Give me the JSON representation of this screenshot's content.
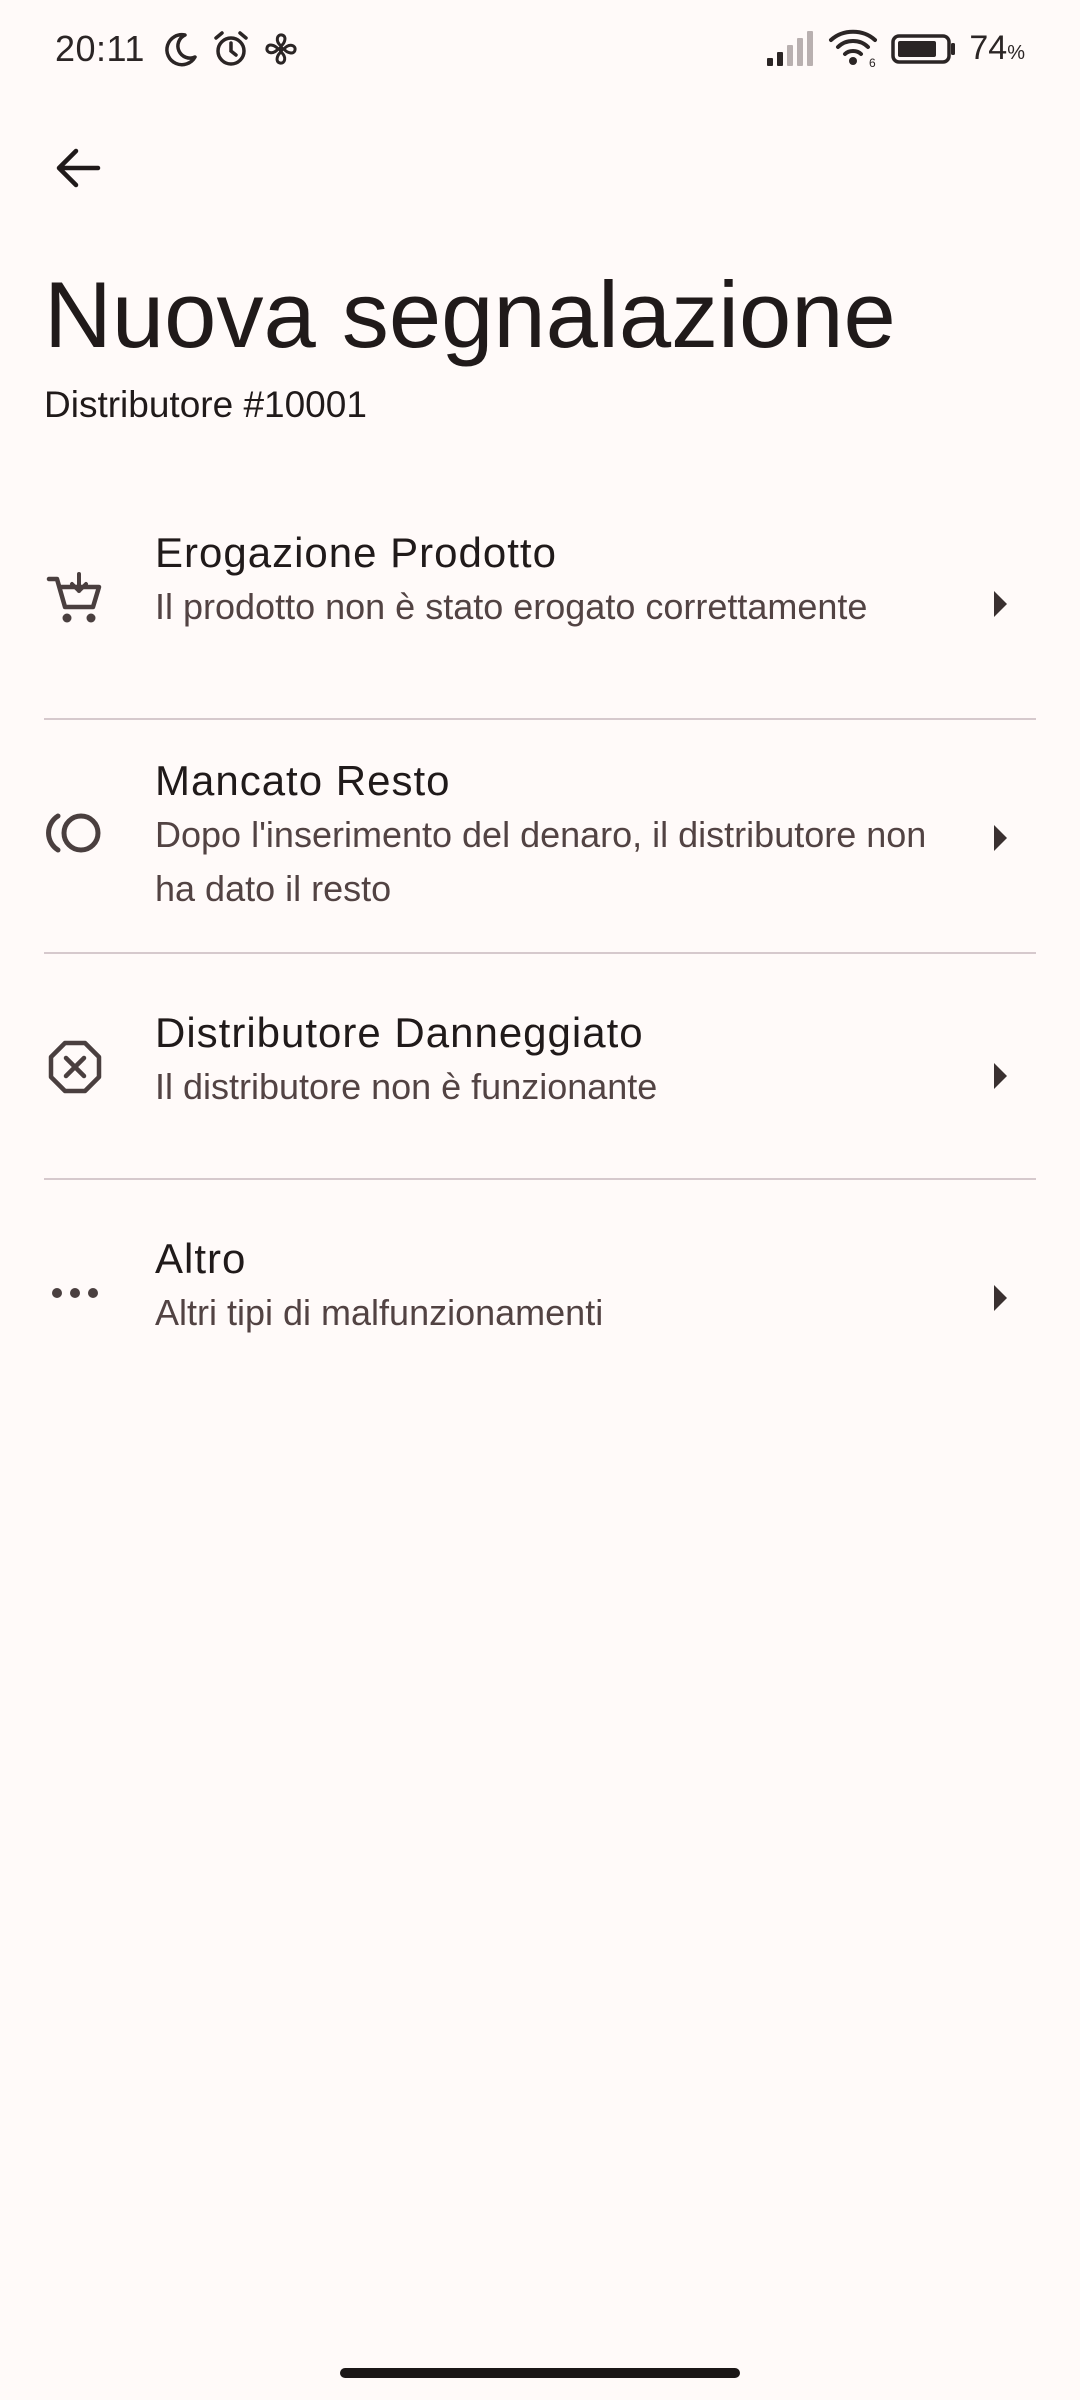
{
  "status_bar": {
    "time": "20:11",
    "battery_percent": "74",
    "battery_unit": "%",
    "icons": [
      "moon-icon",
      "alarm-icon",
      "fan-icon",
      "signal-icon",
      "wifi-icon",
      "battery-icon"
    ],
    "wifi_label": "6"
  },
  "header": {
    "back_icon": "arrow-left-icon",
    "title": "Nuova segnalazione",
    "subtitle": "Distributore #10001"
  },
  "issues": [
    {
      "icon": "cart-icon",
      "title": "Erogazione Prodotto",
      "description": "Il prodotto non è stato erogato correttamente"
    },
    {
      "icon": "coins-icon",
      "title": "Mancato Resto",
      "description": "Dopo l'inserimento del denaro, il distributore non ha dato il resto"
    },
    {
      "icon": "error-octagon-icon",
      "title": "Distributore Danneggiato",
      "description": "Il distributore non è funzionante"
    },
    {
      "icon": "more-horiz-icon",
      "title": "Altro",
      "description": "Altri tipi di malfunzionamenti"
    }
  ],
  "colors": {
    "background": "#fffaf9",
    "text_primary": "#201a1a",
    "text_secondary": "#524343",
    "divider": "#d6c9cd",
    "icon": "#4a3f3f"
  }
}
